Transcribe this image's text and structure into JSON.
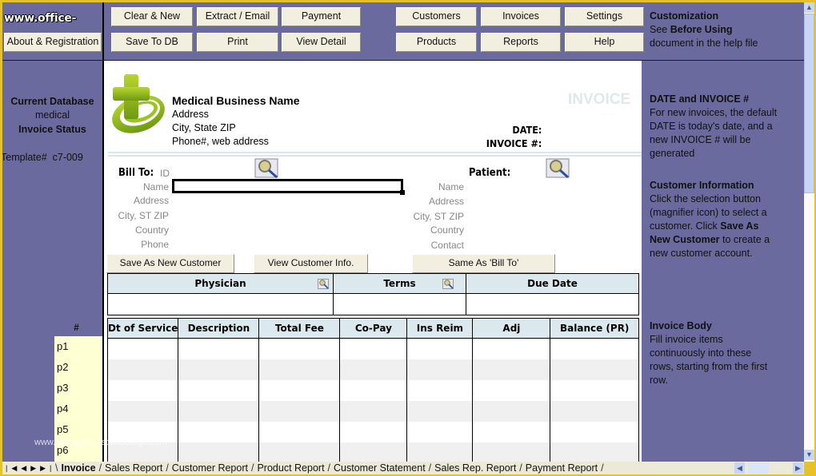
{
  "toolbar": {
    "logo": "www.office-kit.com",
    "about_button": "About & Registration",
    "buttons_row1": [
      "Clear & New",
      "Extract / Email",
      "Payment",
      "Customers",
      "Invoices",
      "Settings"
    ],
    "buttons_row2": [
      "Save To DB",
      "Print",
      "View Detail",
      "Products",
      "Reports",
      "Help"
    ]
  },
  "top_note": {
    "title": "Customization",
    "line2_prefix": "See ",
    "line2_bold": "Before Using",
    "line3": "document in the help file"
  },
  "left_panel": {
    "db_label": "Current Database",
    "db_value": "medical",
    "status_label": "Invoice Status",
    "template": "Template#  c7-009",
    "rows_header": "#",
    "row_labels": [
      "p1",
      "p2",
      "p3",
      "p4",
      "p5",
      "p6"
    ]
  },
  "invoice": {
    "business_name": "Medical Business Name",
    "address": "Address",
    "city_state_zip": "City, State ZIP",
    "phone_web": "Phone#, web address",
    "title": "INVOICE",
    "date_label": "DATE:",
    "invoice_no_label": "INVOICE #:",
    "bill_to": {
      "heading": "Bill To:",
      "id_label": "ID",
      "labels": [
        "Name",
        "Address",
        "City, ST ZIP",
        "Country",
        "Phone"
      ],
      "name_value": ""
    },
    "patient": {
      "heading": "Patient:",
      "labels": [
        "Name",
        "Address",
        "City, ST ZIP",
        "Country",
        "Contact"
      ]
    },
    "buttons": {
      "save_new_customer": "Save As New Customer",
      "view_customer_info": "View Customer Info.",
      "same_as_bill_to": "Same As 'Bill To'"
    },
    "info_table": {
      "headers": [
        "Physician",
        "Terms",
        "Due Date"
      ],
      "values": [
        "",
        "",
        ""
      ]
    },
    "items_table": {
      "headers": [
        "Dt of Service",
        "Description",
        "Total Fee",
        "Co-Pay",
        "Ins Reim",
        "Adj",
        "Balance (PR)"
      ],
      "rows": [
        [
          "",
          "",
          "",
          "",
          "",
          "",
          ""
        ],
        [
          "",
          "",
          "",
          "",
          "",
          "",
          ""
        ],
        [
          "",
          "",
          "",
          "",
          "",
          "",
          ""
        ],
        [
          "",
          "",
          "",
          "",
          "",
          "",
          ""
        ],
        [
          "",
          "",
          "",
          "",
          "",
          "",
          ""
        ],
        [
          "",
          "",
          "",
          "",
          "",
          "",
          ""
        ]
      ]
    }
  },
  "right_notes": [
    {
      "heading": "DATE and INVOICE #",
      "body": "For new invoices, the default DATE is today's date, and a new INVOICE # will be generated"
    },
    {
      "heading": "Customer Information",
      "body_parts": [
        "Click the selection button (magnifier icon) to select a customer. Click ",
        "Save As New Customer",
        " to create a new customer account."
      ]
    },
    {
      "heading": "Invoice Body",
      "body": "Fill invoice items continuously into these rows, starting from the first row."
    }
  ],
  "sheet_tabs": [
    "Invoice",
    "Sales Report",
    "Customer Report",
    "Product Report",
    "Customer Statement",
    "Sales Rep. Report",
    "Payment Report"
  ],
  "active_tab": "Invoice",
  "watermark": "www.heritagechristiancollege.com"
}
